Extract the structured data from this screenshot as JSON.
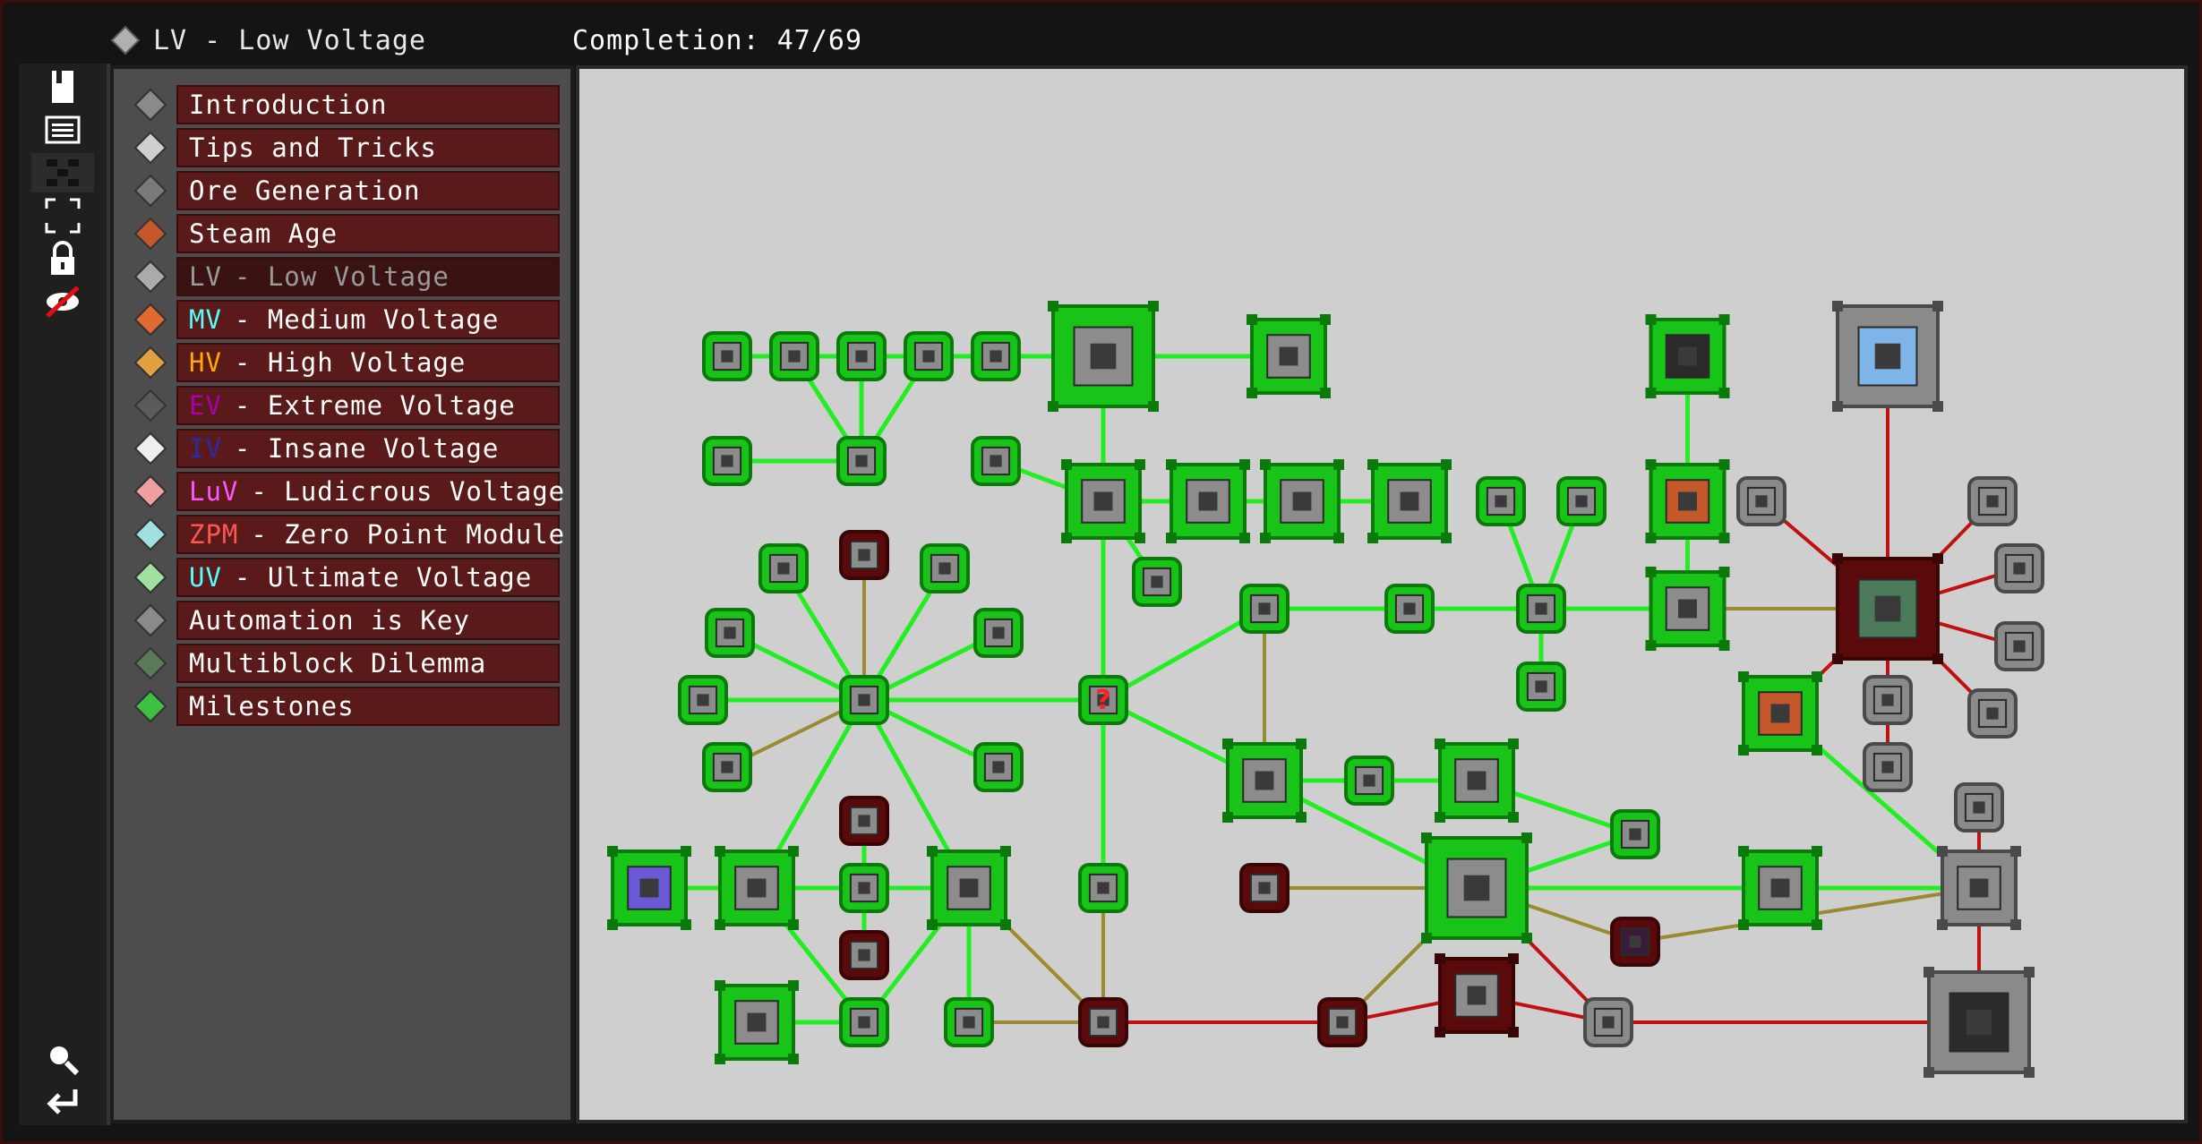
{
  "header": {
    "chapter_title": "LV - Low Voltage",
    "completion": "Completion: 47/69"
  },
  "toolbar": [
    {
      "name": "quest-book-icon"
    },
    {
      "name": "description-icon"
    },
    {
      "name": "tree-view-icon"
    },
    {
      "name": "fullscreen-icon"
    },
    {
      "name": "lock-icon"
    },
    {
      "name": "hide-completed-icon"
    },
    {
      "name": "search-icon"
    },
    {
      "name": "back-icon"
    }
  ],
  "chapters": [
    {
      "label": "Introduction",
      "prefix": "",
      "prefix_color": "",
      "icon_color": "#8a8a8a"
    },
    {
      "label": "Tips and Tricks",
      "prefix": "",
      "prefix_color": "",
      "icon_color": "#cfcfcf"
    },
    {
      "label": "Ore Generation",
      "prefix": "",
      "prefix_color": "",
      "icon_color": "#7a7a7a"
    },
    {
      "label": "Steam Age",
      "prefix": "",
      "prefix_color": "",
      "icon_color": "#c4582a"
    },
    {
      "label": "- Low Voltage",
      "prefix": "LV",
      "prefix_color": "#9a9a9a",
      "icon_color": "#aaaaaa"
    },
    {
      "label": "- Medium Voltage",
      "prefix": "MV",
      "prefix_color": "#55ffff",
      "icon_color": "#e06a30"
    },
    {
      "label": "- High Voltage",
      "prefix": "HV",
      "prefix_color": "#ffaa00",
      "icon_color": "#e0a040"
    },
    {
      "label": "- Extreme Voltage",
      "prefix": "EV",
      "prefix_color": "#aa00aa",
      "icon_color": "#5a5a5a"
    },
    {
      "label": "- Insane Voltage",
      "prefix": "IV",
      "prefix_color": "#2a2aa8",
      "icon_color": "#eeeeee"
    },
    {
      "label": "- Ludicrous Voltage",
      "prefix": "LuV",
      "prefix_color": "#ff55ff",
      "icon_color": "#f0a0a0"
    },
    {
      "label": "- Zero Point Module",
      "prefix": "ZPM",
      "prefix_color": "#ff5555",
      "icon_color": "#a0e0e0"
    },
    {
      "label": "- Ultimate Voltage",
      "prefix": "UV",
      "prefix_color": "#55ffff",
      "icon_color": "#a0e0a0"
    },
    {
      "label": "Automation is Key",
      "prefix": "",
      "prefix_color": "",
      "icon_color": "#8a8a8a"
    },
    {
      "label": "Multiblock Dilemma",
      "prefix": "",
      "prefix_color": "",
      "icon_color": "#5a7a5a"
    },
    {
      "label": "Milestones",
      "prefix": "",
      "prefix_color": "",
      "icon_color": "#40c040"
    }
  ],
  "selected_chapter": "- Low Voltage",
  "colors": {
    "done_fill": "#18c418",
    "done_border": "#0a7a0a",
    "locked_fill": "#5a0a0a",
    "locked_border": "#3a0505",
    "avail_fill": "#8a8a8a",
    "avail_border": "#4a4a4a",
    "link_done": "#22ee22",
    "link_partial": "#9a8a30",
    "link_locked": "#c01010",
    "question_mark": "#ff2020",
    "sky_item": "#7fb4e8",
    "orange_machine": "#c4582a"
  },
  "quests": [
    {
      "id": "cable",
      "status": "done",
      "kind": "small",
      "icon": "cable-icon"
    },
    {
      "id": "ring",
      "status": "done",
      "kind": "small",
      "icon": "ring-icon"
    },
    {
      "id": "wrench",
      "status": "done",
      "kind": "small",
      "icon": "wrench-icon"
    },
    {
      "id": "screwdriver",
      "status": "done",
      "kind": "small",
      "icon": "screwdriver-icon"
    },
    {
      "id": "pump",
      "status": "done",
      "kind": "small",
      "icon": "pump-icon"
    },
    {
      "id": "lv_main",
      "status": "done",
      "kind": "big",
      "icon": "lv-circuit-icon"
    },
    {
      "id": "fan_casing",
      "status": "done",
      "kind": "mid",
      "icon": "fan-casing-icon"
    },
    {
      "id": "casing_a",
      "status": "done",
      "kind": "small",
      "icon": "hull-icon"
    },
    {
      "id": "crafting",
      "status": "done",
      "kind": "small",
      "icon": "crafting-icon"
    },
    {
      "id": "funnel",
      "status": "done",
      "kind": "small",
      "icon": "funnel-icon"
    },
    {
      "id": "assembler",
      "status": "done",
      "kind": "mid",
      "icon": "assembler-icon"
    },
    {
      "id": "mixer",
      "status": "done",
      "kind": "mid",
      "icon": "mixer-icon"
    },
    {
      "id": "compressor",
      "status": "done",
      "kind": "mid",
      "icon": "compressor-icon"
    },
    {
      "id": "furnace",
      "status": "done",
      "kind": "mid",
      "icon": "electric-furnace-icon"
    },
    {
      "id": "arm",
      "status": "done",
      "kind": "small",
      "icon": "robot-arm-icon"
    },
    {
      "id": "hammer",
      "status": "done",
      "kind": "small",
      "icon": "forge-hammer-icon"
    },
    {
      "id": "black_block",
      "status": "done",
      "kind": "mid",
      "icon": "black-block-icon"
    },
    {
      "id": "sky_ingot",
      "status": "available",
      "kind": "big",
      "icon": "sky-ingot-icon"
    },
    {
      "id": "orange_machine",
      "status": "done",
      "kind": "mid",
      "icon": "orange-machine-icon"
    },
    {
      "id": "monitor",
      "status": "done",
      "kind": "small",
      "icon": "monitor-icon"
    },
    {
      "id": "machine_1",
      "status": "locked",
      "kind": "small",
      "icon": "machine-icon"
    },
    {
      "id": "machine_2",
      "status": "done",
      "kind": "small",
      "icon": "machine-icon"
    },
    {
      "id": "machine_3",
      "status": "done",
      "kind": "small",
      "icon": "machine-icon"
    },
    {
      "id": "machine_4",
      "status": "done",
      "kind": "small",
      "icon": "machine-icon"
    },
    {
      "id": "machine_5",
      "status": "done",
      "kind": "small",
      "icon": "machine-icon"
    },
    {
      "id": "hub",
      "status": "done",
      "kind": "small",
      "icon": "gear-hub-icon"
    },
    {
      "id": "question",
      "status": "done",
      "kind": "small",
      "icon": "question-icon"
    },
    {
      "id": "box_small",
      "status": "done",
      "kind": "small",
      "icon": "box-icon"
    },
    {
      "id": "plate",
      "status": "done",
      "kind": "small",
      "icon": "plate-icon"
    },
    {
      "id": "info",
      "status": "done",
      "kind": "small",
      "icon": "info-icon"
    },
    {
      "id": "steel_block",
      "status": "done",
      "kind": "mid",
      "icon": "steel-block-icon"
    },
    {
      "id": "multiblock",
      "status": "locked",
      "kind": "big",
      "icon": "multiblock-controller-icon"
    },
    {
      "id": "wire_coil",
      "status": "available",
      "kind": "small",
      "icon": "gauge-icon"
    },
    {
      "id": "side_a",
      "status": "available",
      "kind": "small",
      "icon": "hatch-icon"
    },
    {
      "id": "side_b",
      "status": "available",
      "kind": "small",
      "icon": "hatch-icon"
    },
    {
      "id": "side_c",
      "status": "available",
      "kind": "small",
      "icon": "hatch-icon"
    },
    {
      "id": "side_d",
      "status": "available",
      "kind": "small",
      "icon": "hatch-icon"
    },
    {
      "id": "side_e",
      "status": "available",
      "kind": "small",
      "icon": "hatch-icon"
    },
    {
      "id": "side_f",
      "status": "available",
      "kind": "small",
      "icon": "hatch-icon"
    },
    {
      "id": "crate",
      "status": "done",
      "kind": "mid",
      "icon": "crate-icon"
    },
    {
      "id": "chip",
      "status": "done",
      "kind": "small",
      "icon": "chip-icon"
    },
    {
      "id": "bender",
      "status": "done",
      "kind": "mid",
      "icon": "bender-icon"
    },
    {
      "id": "battery",
      "status": "done",
      "kind": "small",
      "icon": "battery-icon"
    },
    {
      "id": "lathe",
      "status": "done",
      "kind": "mid",
      "icon": "lathe-icon"
    },
    {
      "id": "gravel",
      "status": "done",
      "kind": "small",
      "icon": "gravel-icon"
    },
    {
      "id": "big_machine",
      "status": "done",
      "kind": "big",
      "icon": "big-machine-icon"
    },
    {
      "id": "can",
      "status": "locked",
      "kind": "small",
      "icon": "spray-can-icon"
    },
    {
      "id": "purple_block",
      "status": "locked",
      "kind": "small",
      "icon": "purple-block-icon"
    },
    {
      "id": "drum",
      "status": "done",
      "kind": "mid",
      "icon": "drum-icon"
    },
    {
      "id": "ghost_item",
      "status": "available",
      "kind": "small",
      "icon": "ghost-ingot-icon"
    },
    {
      "id": "mv_machine",
      "status": "available",
      "kind": "mid",
      "icon": "mv-machine-icon"
    },
    {
      "id": "slime",
      "status": "done",
      "kind": "mid",
      "icon": "slime-icon"
    },
    {
      "id": "macerator",
      "status": "done",
      "kind": "mid",
      "icon": "macerator-icon"
    },
    {
      "id": "extractor",
      "status": "done",
      "kind": "small",
      "icon": "extractor-icon"
    },
    {
      "id": "centrifuge",
      "status": "done",
      "kind": "mid",
      "icon": "centrifuge-icon"
    },
    {
      "id": "locked_top",
      "status": "locked",
      "kind": "small",
      "icon": "machine-icon"
    },
    {
      "id": "locked_mid",
      "status": "locked",
      "kind": "small",
      "icon": "circuit-icon"
    },
    {
      "id": "cleanroom",
      "status": "done",
      "kind": "mid",
      "icon": "cleanroom-icon"
    },
    {
      "id": "flask",
      "status": "done",
      "kind": "small",
      "icon": "flask-icon"
    },
    {
      "id": "bucket",
      "status": "done",
      "kind": "small",
      "icon": "bucket-icon"
    },
    {
      "id": "dust",
      "status": "locked",
      "kind": "small",
      "icon": "dust-icon"
    },
    {
      "id": "grate",
      "status": "locked",
      "kind": "small",
      "icon": "grate-icon"
    },
    {
      "id": "filter",
      "status": "locked",
      "kind": "mid",
      "icon": "filter-casing-icon"
    },
    {
      "id": "vial",
      "status": "available",
      "kind": "small",
      "icon": "vial-icon"
    },
    {
      "id": "computer",
      "status": "available",
      "kind": "big",
      "icon": "computer-icon"
    },
    {
      "id": "machine_6",
      "status": "done",
      "kind": "small",
      "icon": "machine-icon"
    },
    {
      "id": "hopper_like",
      "status": "done",
      "kind": "small",
      "icon": "machine-icon"
    },
    {
      "id": "pump2",
      "status": "done",
      "kind": "small",
      "icon": "hull-icon"
    },
    {
      "id": "ext_left",
      "status": "done",
      "kind": "small",
      "icon": "machine-icon"
    }
  ]
}
